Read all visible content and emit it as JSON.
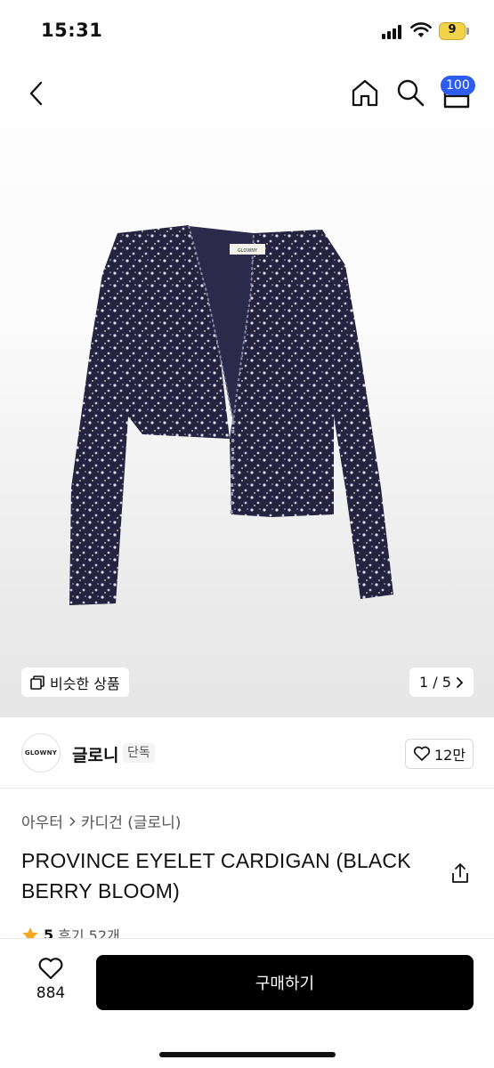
{
  "status_bar": {
    "time": "15:31",
    "battery_level": "9"
  },
  "nav": {
    "cart_count": "100"
  },
  "gallery": {
    "similar_label": "비슷한 상품",
    "page_indicator": "1 / 5",
    "garment_tag": "GLOWNY"
  },
  "brand": {
    "logo_text": "GLOWNY",
    "name": "글로니",
    "tag": "단독",
    "likes": "12만"
  },
  "product": {
    "breadcrumb": [
      "아우터",
      "카디건 (글로니)"
    ],
    "title": "PROVINCE EYELET CARDIGAN (BLACK BERRY BLOOM)",
    "rating": "5",
    "reviews": "후기 52개"
  },
  "bottom_bar": {
    "wish_count": "884",
    "buy_label": "구매하기"
  },
  "colors": {
    "accent_badge": "#2d5cf0",
    "buy_button": "#000000",
    "star": "#f5a623",
    "cardigan": "#24223d"
  },
  "icons": [
    "back-icon",
    "home-icon",
    "search-icon",
    "cart-icon",
    "copy-icon",
    "chevron-right-icon",
    "heart-icon",
    "share-icon",
    "star-icon"
  ]
}
